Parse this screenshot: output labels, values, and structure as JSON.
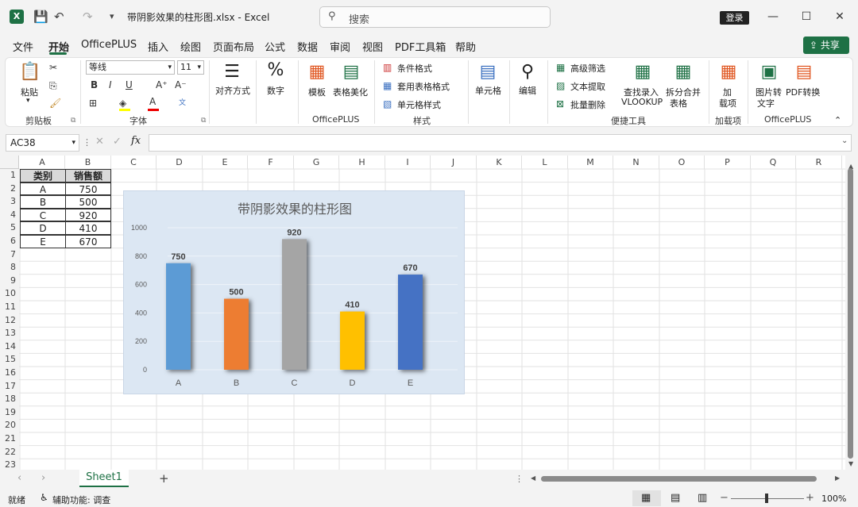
{
  "titlebar": {
    "app_icon": "X",
    "doc_title": "带阴影效果的柱形图.xlsx  -  Excel",
    "search_placeholder": "搜索",
    "login_label": "登录",
    "minimize": "—",
    "maximize": "☐",
    "close": "✕"
  },
  "tabs": [
    "文件",
    "开始",
    "OfficePLUS",
    "插入",
    "绘图",
    "页面布局",
    "公式",
    "数据",
    "审阅",
    "视图",
    "PDF工具箱",
    "帮助"
  ],
  "share_label": "共享",
  "ribbon": {
    "paste": "粘贴",
    "clipboard": "剪贴板",
    "font_name": "等线",
    "font_size": "11",
    "font_group": "字体",
    "align": "对齐方式",
    "number": "数字",
    "template": "模板",
    "beautify": "表格美化",
    "officeplus_group": "OfficePLUS",
    "cond_format": "条件格式",
    "table_style": "套用表格格式",
    "cell_style": "单元格样式",
    "style_group": "样式",
    "cells": "单元格",
    "editing": "编辑",
    "adv_filter": "高级筛选",
    "text_extract": "文本提取",
    "batch_delete": "批量删除",
    "lookup_line1": "查找录入",
    "lookup_line2": "VLOOKUP",
    "split_line1": "拆分合并",
    "split_line2": "表格",
    "tools_group": "便捷工具",
    "addin_line1": "加",
    "addin_line2": "载项",
    "addin_group": "加载项",
    "img2text_line1": "图片转",
    "img2text_line2": "文字",
    "pdfconv": "PDF转换",
    "officeplus2_group": "OfficePLUS"
  },
  "formula_bar": {
    "name_box": "AC38",
    "fx": "fx",
    "formula": ""
  },
  "columns": [
    "A",
    "B",
    "C",
    "D",
    "E",
    "F",
    "G",
    "H",
    "I",
    "J",
    "K",
    "L",
    "M",
    "N",
    "O",
    "P",
    "Q",
    "R"
  ],
  "rows": [
    "1",
    "2",
    "3",
    "4",
    "5",
    "6",
    "7",
    "8",
    "9",
    "10",
    "11",
    "12",
    "13",
    "14",
    "15",
    "16",
    "17",
    "18",
    "19",
    "20",
    "21",
    "22",
    "23"
  ],
  "table": {
    "headers": [
      "类别",
      "销售额"
    ],
    "rows": [
      [
        "A",
        "750"
      ],
      [
        "B",
        "500"
      ],
      [
        "C",
        "920"
      ],
      [
        "D",
        "410"
      ],
      [
        "E",
        "670"
      ]
    ]
  },
  "chart_data": {
    "type": "bar",
    "title": "带阴影效果的柱形图",
    "categories": [
      "A",
      "B",
      "C",
      "D",
      "E"
    ],
    "values": [
      750,
      500,
      920,
      410,
      670
    ],
    "colors": [
      "#5b9bd5",
      "#ed7d31",
      "#a5a5a5",
      "#ffc000",
      "#4472c4"
    ],
    "ylim": [
      0,
      1000
    ],
    "yticks": [
      0,
      200,
      400,
      600,
      800,
      1000
    ],
    "grid": true,
    "data_labels": true,
    "shadow": true
  },
  "sheet_tab": "Sheet1",
  "status": {
    "ready": "就绪",
    "accessibility": "辅助功能: 调查",
    "zoom": "100%"
  }
}
